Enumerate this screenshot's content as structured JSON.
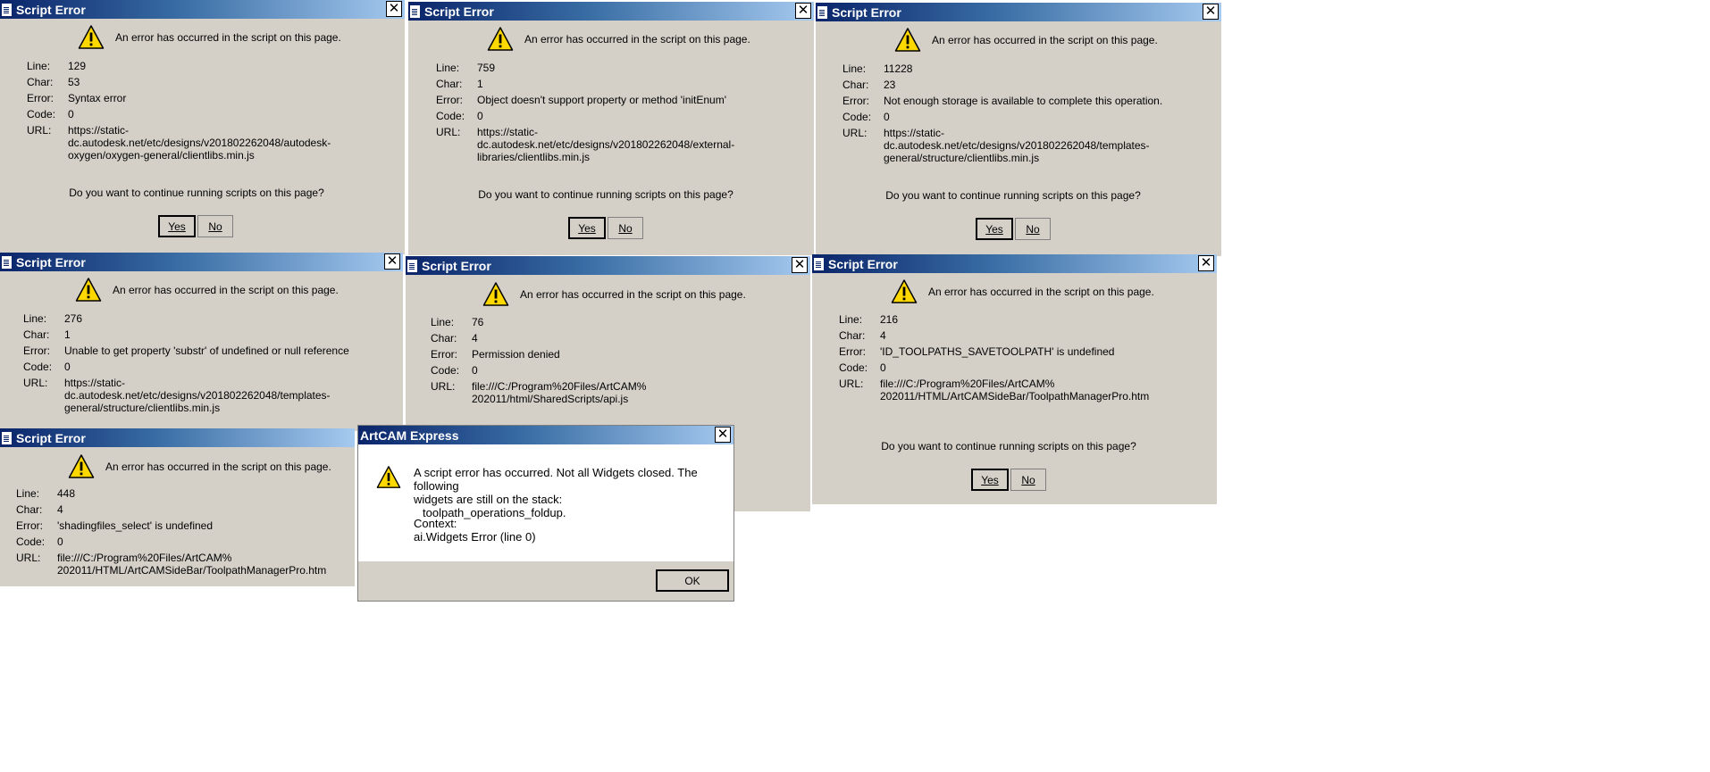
{
  "dialogs": [
    {
      "title": "Script Error",
      "message": "An error has occurred in the script on this page.",
      "labels": {
        "line": "Line:",
        "char": "Char:",
        "error": "Error:",
        "code": "Code:",
        "url": "URL:"
      },
      "line": "129",
      "char": "53",
      "error": "Syntax error",
      "code": "0",
      "url": "https://static-\ndc.autodesk.net/etc/designs/v201802262048/autodesk-\noxygen/oxygen-general/clientlibs.min.js",
      "question": "Do you want to continue running scripts on this page?",
      "yes_label": "Yes",
      "no_label": "No"
    },
    {
      "title": "Script Error",
      "message": "An error has occurred in the script on this page.",
      "labels": {
        "line": "Line:",
        "char": "Char:",
        "error": "Error:",
        "code": "Code:",
        "url": "URL:"
      },
      "line": "759",
      "char": "1",
      "error": "Object doesn't support property or method 'initEnum'",
      "code": "0",
      "url": "https://static-\ndc.autodesk.net/etc/designs/v201802262048/external-\nlibraries/clientlibs.min.js",
      "question": "Do you want to continue running scripts on this page?",
      "yes_label": "Yes",
      "no_label": "No"
    },
    {
      "title": "Script Error",
      "message": "An error has occurred in the script on this page.",
      "labels": {
        "line": "Line:",
        "char": "Char:",
        "error": "Error:",
        "code": "Code:",
        "url": "URL:"
      },
      "line": "11228",
      "char": "23",
      "error": "Not enough storage is available to complete this operation.",
      "code": "0",
      "url": "https://static-\ndc.autodesk.net/etc/designs/v201802262048/templates-\ngeneral/structure/clientlibs.min.js",
      "question": "Do you want to continue running scripts on this page?",
      "yes_label": "Yes",
      "no_label": "No"
    },
    {
      "title": "Script Error",
      "message": "An error has occurred in the script on this page.",
      "labels": {
        "line": "Line:",
        "char": "Char:",
        "error": "Error:",
        "code": "Code:",
        "url": "URL:"
      },
      "line": "276",
      "char": "1",
      "error": "Unable to get property 'substr' of undefined or null reference",
      "code": "0",
      "url": "https://static-\ndc.autodesk.net/etc/designs/v201802262048/templates-\ngeneral/structure/clientlibs.min.js"
    },
    {
      "title": "Script Error",
      "message": "An error has occurred in the script on this page.",
      "labels": {
        "line": "Line:",
        "char": "Char:",
        "error": "Error:",
        "code": "Code:",
        "url": "URL:"
      },
      "line": "76",
      "char": "4",
      "error": "Permission denied",
      "code": "0",
      "url": "file:///C:/Program%20Files/ArtCAM%\n202011/html/SharedScripts/api.js"
    },
    {
      "title": "Script Error",
      "message": "An error has occurred in the script on this page.",
      "labels": {
        "line": "Line:",
        "char": "Char:",
        "error": "Error:",
        "code": "Code:",
        "url": "URL:"
      },
      "line": "216",
      "char": "4",
      "error": "'ID_TOOLPATHS_SAVETOOLPATH' is undefined",
      "code": "0",
      "url": "file:///C:/Program%20Files/ArtCAM%\n202011/HTML/ArtCAMSideBar/ToolpathManagerPro.htm",
      "question": "Do you want to continue running scripts on this page?",
      "yes_label": "Yes",
      "no_label": "No"
    },
    {
      "title": "Script Error",
      "message": "An error has occurred in the script on this page.",
      "labels": {
        "line": "Line:",
        "char": "Char:",
        "error": "Error:",
        "code": "Code:",
        "url": "URL:"
      },
      "line": "448",
      "char": "4",
      "error": "'shadingfiles_select' is undefined",
      "code": "0",
      "url": "file:///C:/Program%20Files/ArtCAM%\n202011/HTML/ArtCAMSideBar/ToolpathManagerPro.htm"
    }
  ],
  "artcam": {
    "title": "ArtCAM Express",
    "message_line1": "A script error has occurred. Not all Widgets closed. The following",
    "message_line2": "widgets are still on the stack:",
    "message_line3": "toolpath_operations_foldup.",
    "context_label": "Context:",
    "context_value": "ai.Widgets Error (line 0)",
    "ok_label": "OK"
  },
  "icons": [
    "page-icon",
    "warning-icon",
    "close-icon"
  ],
  "colors": {
    "dialog_bg": "#d4d0c8",
    "title_dark": "#0a246a",
    "title_light": "#a6caf0",
    "warning_yellow": "#ffd800"
  }
}
